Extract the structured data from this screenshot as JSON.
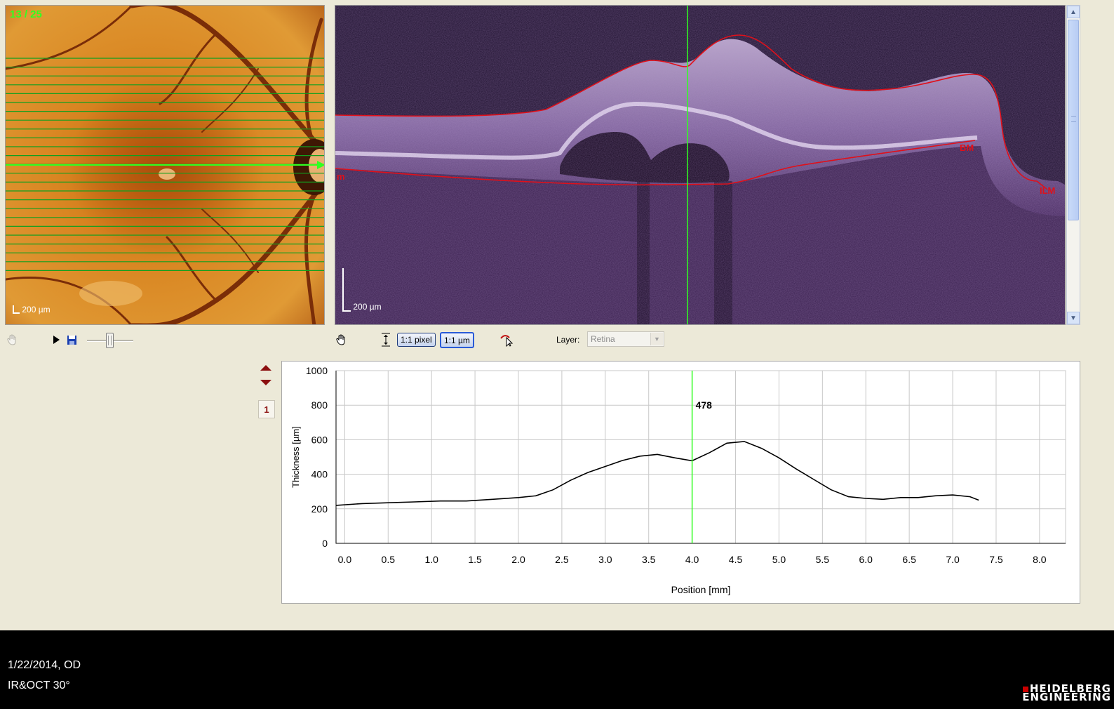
{
  "fundus": {
    "counter": "13 / 25",
    "scale_label": "200 µm"
  },
  "oct": {
    "scale_label": "200 µm",
    "labels": {
      "left": "m",
      "bm": "BM",
      "ilm": "ILM"
    }
  },
  "left_toolbar": {
    "icons": [
      "hand-icon",
      "play-icon",
      "save-icon",
      "slider"
    ]
  },
  "oct_toolbar": {
    "pixel_button": "1:1 pixel",
    "um_button": "1:1 µm",
    "layer_label": "Layer:",
    "layer_value": "Retina"
  },
  "page_number": "1",
  "chart_data": {
    "type": "line",
    "xlabel": "Position [mm]",
    "ylabel": "Thickness [µm]",
    "xlim": [
      -0.1,
      8.3
    ],
    "ylim": [
      0,
      1000
    ],
    "x_ticks": [
      "0.0",
      "0.5",
      "1.0",
      "1.5",
      "2.0",
      "2.5",
      "3.0",
      "3.5",
      "4.0",
      "4.5",
      "5.0",
      "5.5",
      "6.0",
      "6.5",
      "7.0",
      "7.5",
      "8.0"
    ],
    "y_ticks": [
      "0",
      "200",
      "400",
      "600",
      "800",
      "1000"
    ],
    "grid": true,
    "cursor_x": 4.0,
    "cursor_label": "478",
    "x": [
      -0.1,
      0.2,
      0.5,
      0.8,
      1.1,
      1.4,
      1.7,
      2.0,
      2.2,
      2.4,
      2.6,
      2.8,
      3.0,
      3.2,
      3.4,
      3.6,
      3.8,
      4.0,
      4.2,
      4.4,
      4.6,
      4.8,
      5.0,
      5.2,
      5.4,
      5.6,
      5.8,
      6.0,
      6.2,
      6.4,
      6.6,
      6.8,
      7.0,
      7.2,
      7.3
    ],
    "y": [
      220,
      230,
      235,
      240,
      245,
      245,
      255,
      265,
      275,
      310,
      365,
      410,
      445,
      480,
      505,
      515,
      495,
      478,
      525,
      580,
      590,
      550,
      495,
      430,
      370,
      310,
      270,
      260,
      255,
      265,
      265,
      275,
      280,
      270,
      250
    ]
  },
  "footer": {
    "date": "1/22/2014, OD",
    "modality": "IR&OCT 30°",
    "brand_line1": "HEIDELBERG",
    "brand_line2": "ENGINEERING"
  },
  "colors": {
    "accent_green": "#31ff21",
    "segmentation_red": "#e0101a",
    "footer_bg": "#000000",
    "panel_bg": "#ece9d8"
  }
}
